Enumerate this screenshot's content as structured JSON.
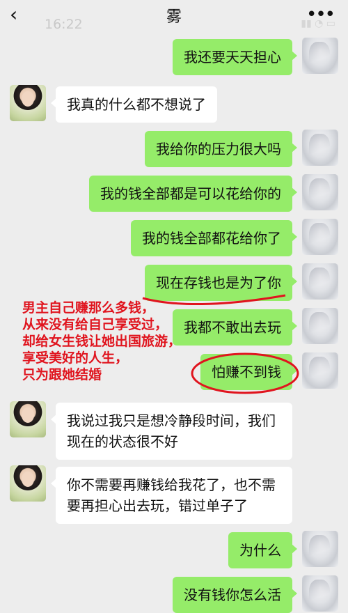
{
  "header": {
    "back_glyph": "‹",
    "time": "16:22",
    "title": "雾",
    "more_glyph": "•••"
  },
  "messages": [
    {
      "from": "me",
      "text": "我还要天天担心"
    },
    {
      "from": "her",
      "text": "我真的什么都不想说了"
    },
    {
      "from": "me",
      "text": "我给你的压力很大吗"
    },
    {
      "from": "me",
      "text": "我的钱全部都是可以花给你的"
    },
    {
      "from": "me",
      "text": "我的钱全部都花给你了"
    },
    {
      "from": "me",
      "text": "现在存钱也是为了你"
    },
    {
      "from": "me",
      "text": "我都不敢出去玩"
    },
    {
      "from": "me",
      "text": "怕赚不到钱"
    },
    {
      "from": "her",
      "lines": [
        "我说过我只是想冷静段时间，我们",
        "现在的状态很不好"
      ]
    },
    {
      "from": "her",
      "lines": [
        "你不需要再赚钱给我花了，也不需",
        "要再担心出去玩，错过单子了"
      ]
    },
    {
      "from": "me",
      "text": "为什么"
    },
    {
      "from": "me",
      "text": "没有钱你怎么活"
    }
  ],
  "annotation": {
    "lines": [
      "男主自己赚那么多钱，",
      "从来没有给自己享受过，",
      "却给女生钱让她出国旅游，",
      "享受美好的人生，",
      "只为跟她结婚"
    ],
    "color": "#e0141e"
  },
  "colors": {
    "me_bubble": "#95ec69",
    "her_bubble": "#ffffff",
    "background": "#ededed"
  }
}
